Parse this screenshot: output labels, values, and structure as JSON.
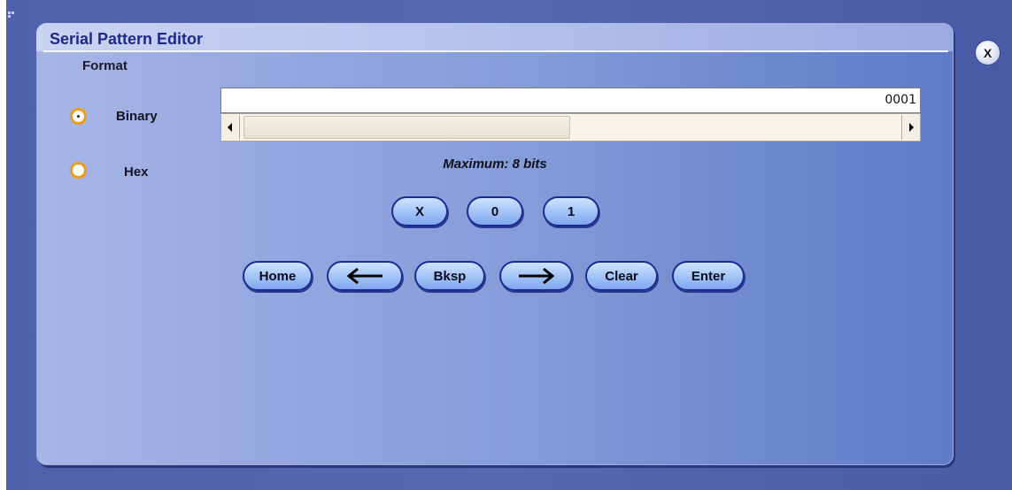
{
  "window": {
    "title": "Serial Pattern Editor",
    "close_label": "X"
  },
  "format": {
    "label": "Format",
    "options": [
      {
        "label": "Binary",
        "selected": true
      },
      {
        "label": "Hex",
        "selected": false
      }
    ]
  },
  "pattern": {
    "value": "0001",
    "maximum_label": "Maximum: 8 bits"
  },
  "bit_buttons": [
    "X",
    "0",
    "1"
  ],
  "edit_buttons": {
    "home": "Home",
    "left": "left-arrow-icon",
    "bksp": "Bksp",
    "right": "right-arrow-icon",
    "clear": "Clear",
    "enter": "Enter"
  },
  "colors": {
    "accent_radio": "#f29b12",
    "title_text": "#1d2a8a",
    "button_border": "#1b2b8e"
  }
}
